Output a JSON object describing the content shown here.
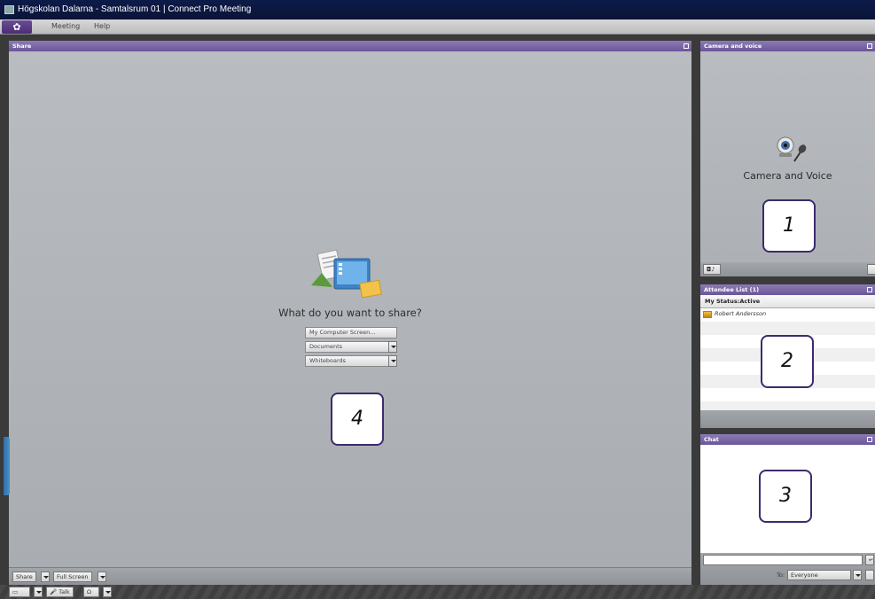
{
  "window": {
    "title": "Högskolan Dalarna - Samtalsrum 01 | Connect Pro Meeting"
  },
  "menu": {
    "items": [
      {
        "label": "Meeting"
      },
      {
        "label": "Help"
      }
    ]
  },
  "share_pod": {
    "header": "Share",
    "question": "What do you want to share?",
    "options": [
      {
        "label": "My Computer Screen..."
      },
      {
        "label": "Documents"
      },
      {
        "label": "Whiteboards"
      }
    ],
    "footer": {
      "share_label": "Share",
      "fullscreen_label": "Full Screen"
    }
  },
  "camera_pod": {
    "header": "Camera and voice",
    "label": "Camera and Voice"
  },
  "attendee_pod": {
    "header": "Attendee List (1)",
    "status_label": "My Status:Active",
    "attendees": [
      {
        "name": "Robert Andersson"
      }
    ]
  },
  "chat_pod": {
    "header": "Chat",
    "to_label": "To:",
    "to_value": "Everyone"
  },
  "bottom_bar": {
    "talk_label": "Talk"
  },
  "callouts": {
    "c1": "1",
    "c2": "2",
    "c3": "3",
    "c4": "4"
  },
  "colors": {
    "accent": "#6a569a",
    "titlebar": "#0d1b4a",
    "pod_bg": "#b6babd"
  }
}
